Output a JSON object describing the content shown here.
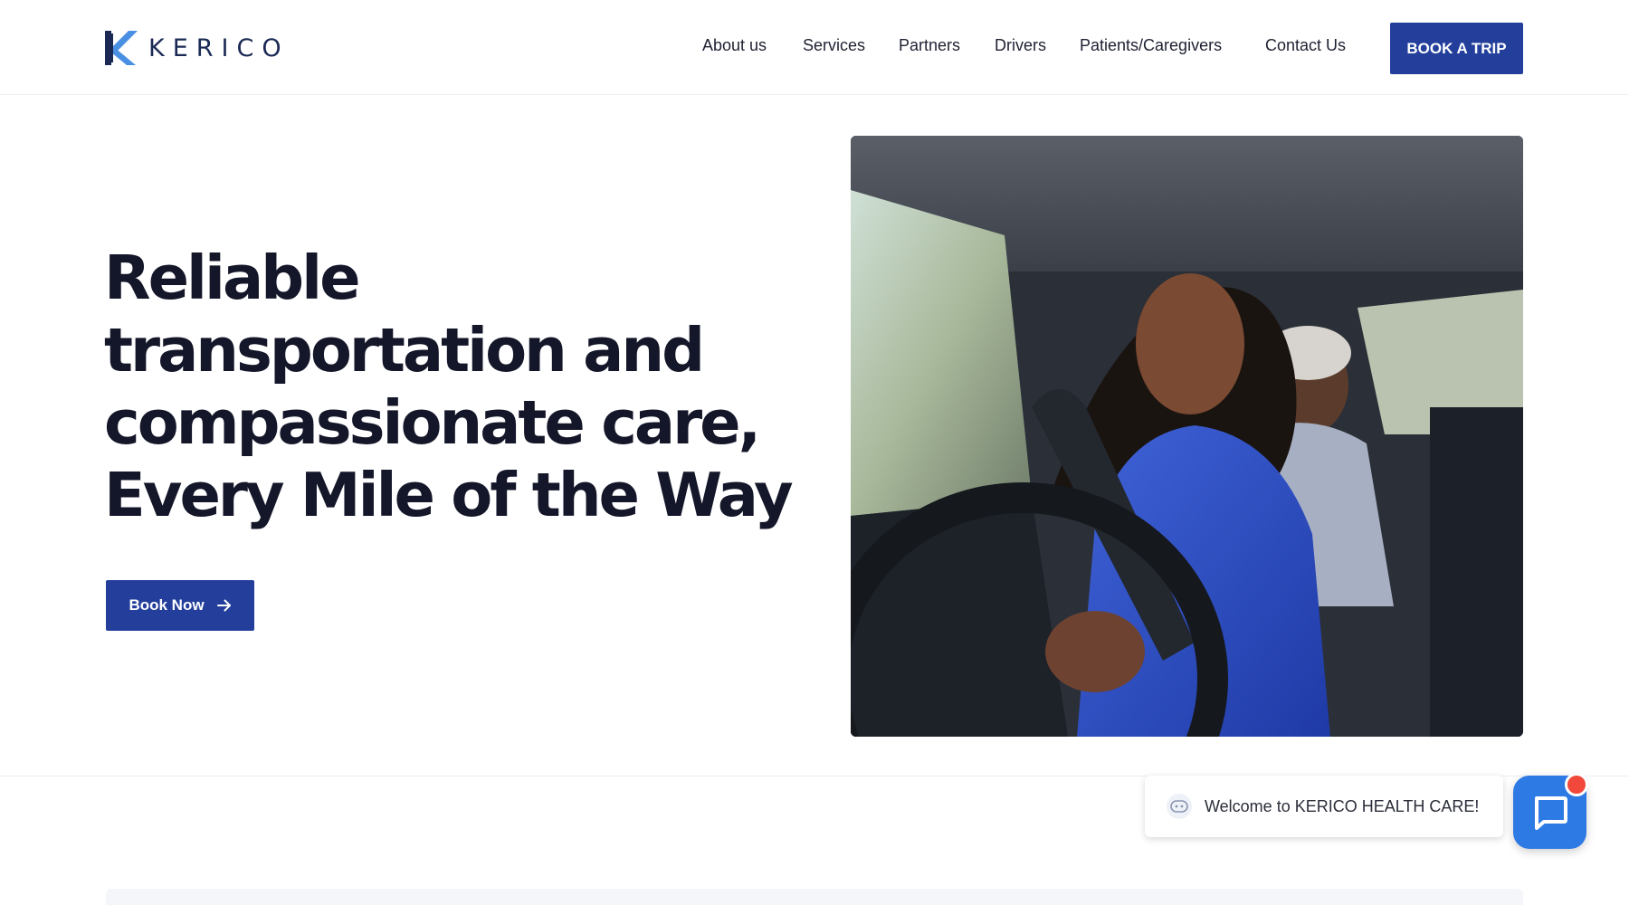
{
  "brand": {
    "name": "KERICO",
    "primary_color": "#233f9b",
    "logo_icon": "kerico-k-logo-icon"
  },
  "nav": {
    "items": [
      {
        "label": "About us"
      },
      {
        "label": "Services"
      },
      {
        "label": "Partners"
      },
      {
        "label": "Drivers"
      },
      {
        "label": "Patients/Caregivers"
      },
      {
        "label": "Contact Us"
      }
    ],
    "cta_label": "BOOK A TRIP"
  },
  "hero": {
    "title_lines": [
      "Reliable",
      "transportation and",
      "compassionate care,",
      "Every Mile of the Way"
    ],
    "button_label": "Book Now",
    "button_icon": "arrow-right-icon",
    "image": "photo of smiling woman driving a car with an older man passenger in the back seat"
  },
  "chat": {
    "welcome_text": "Welcome to KERICO HEALTH CARE!",
    "bubble_icon": "chat-bot-icon",
    "launcher_icon": "chat-icon",
    "launcher_color": "#2e7ae5",
    "badge_color": "#f2483b"
  }
}
